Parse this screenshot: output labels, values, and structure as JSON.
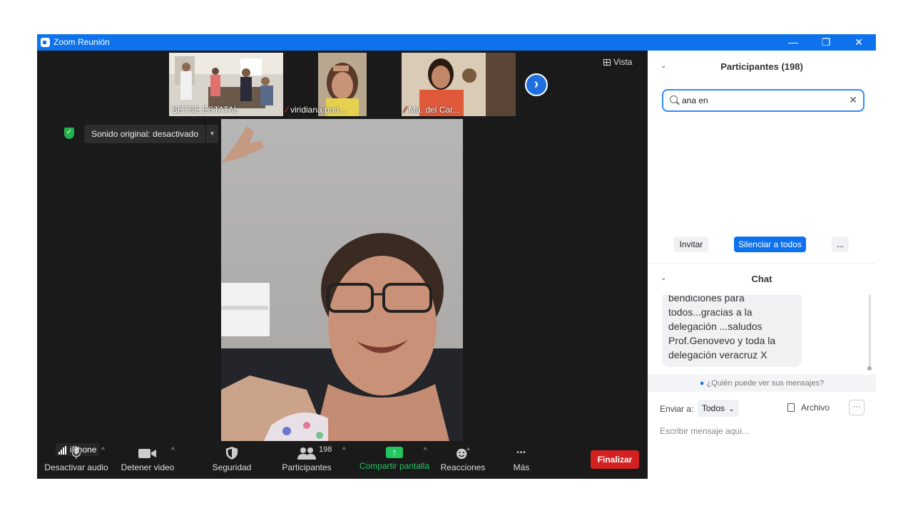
{
  "window": {
    "title": "Zoom Reunión",
    "minimize": "—",
    "restore": "❐",
    "close": "✕"
  },
  "view_button": "Vista",
  "thumbnails": [
    {
      "name": "SETSE ESTATAL",
      "muted": false
    },
    {
      "name": "viridiana port...",
      "muted": true
    },
    {
      "name": "Ma. del Car...",
      "muted": true
    }
  ],
  "next_icon": "chevron-right-icon",
  "next_glyph": "›",
  "sound": {
    "label": "Sonido original: desactivado",
    "arrow": "▼"
  },
  "device_label": "iPhone",
  "toolbar": {
    "audio": "Desactivar audio",
    "video": "Detener video",
    "security": "Seguridad",
    "participants": "Participantes",
    "participants_count": "198",
    "share": "Compartir pantalla",
    "share_glyph": "↑",
    "reactions": "Reacciones",
    "more": "Más",
    "more_glyph": "•••",
    "end": "Finalizar",
    "caret": "^"
  },
  "participants_panel": {
    "title": "Participantes (198)",
    "search_value": "ana en",
    "clear": "✕",
    "invite": "Invitar",
    "mute_all": "Silenciar a todos",
    "more": "..."
  },
  "chat": {
    "title": "Chat",
    "collapse": "⌄",
    "message": "bendiciones para todos...gracias a la delegación ...saludos Prof.Genovevo y toda la delegación veracruz X",
    "who_can_see": "¿Quién puede ver sus mensajes?",
    "send_to_label": "Enviar a:",
    "send_to_value": "Todos",
    "send_to_arrow": "⌄",
    "file": "Archivo",
    "more": "···",
    "input_placeholder": "Escribir mensaje aquí..."
  },
  "colors": {
    "titlebar": "#0e72ed",
    "stage_bg": "#1a1a1a",
    "accent": "#2d8cff",
    "end_button": "#d42020",
    "share_green": "#23c55e"
  }
}
